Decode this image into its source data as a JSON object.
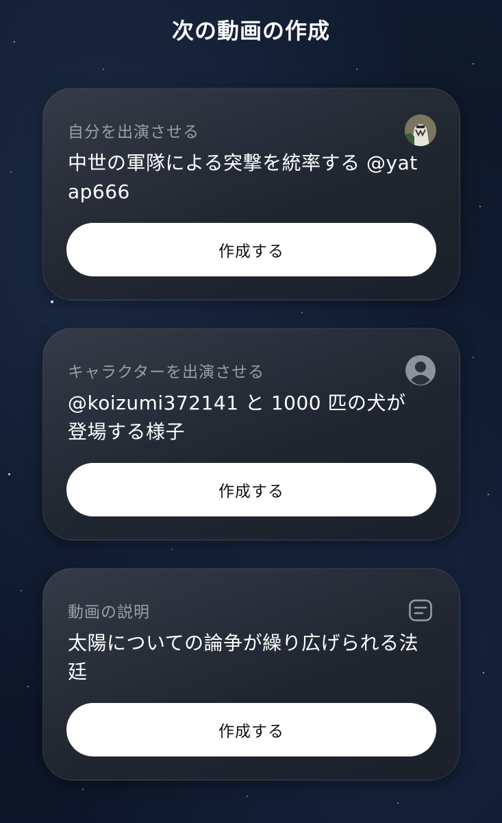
{
  "header": {
    "title": "次の動画の作成"
  },
  "cards": [
    {
      "label": "自分を出演させる",
      "text": "中世の軍隊による突撃を統率する @yatap666",
      "icon": "user-avatar-photo",
      "button_label": "作成する"
    },
    {
      "label": "キャラクターを出演させる",
      "text": "@koizumi372141 と 1000 匹の犬が登場する様子",
      "icon": "person-circle-icon",
      "button_label": "作成する"
    },
    {
      "label": "動画の説明",
      "text": "太陽についての論争が繰り広げられる法廷",
      "icon": "text-document-icon",
      "button_label": "作成する"
    }
  ],
  "colors": {
    "background": "#0d1626",
    "card": "#2a2f3a",
    "button": "#ffffff",
    "label": "#9a9ea6"
  }
}
